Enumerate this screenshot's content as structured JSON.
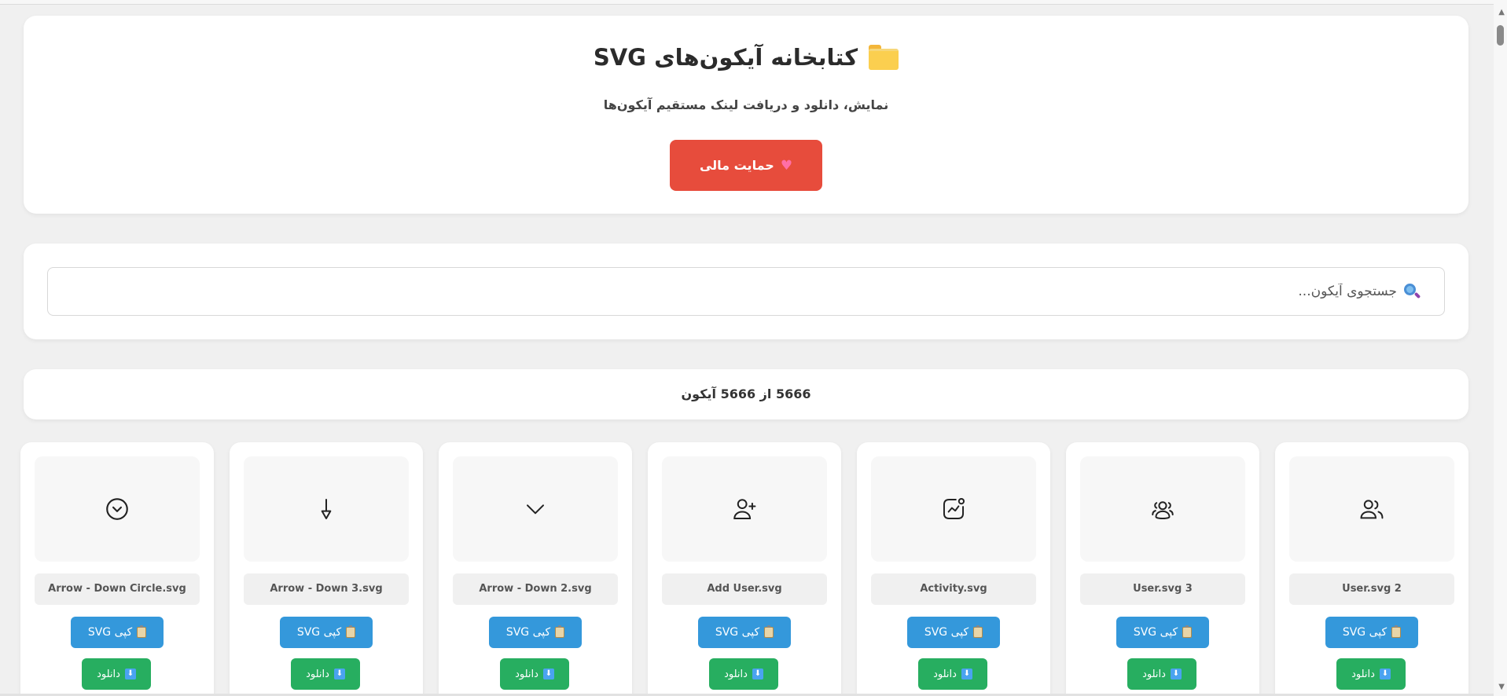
{
  "header": {
    "title": "کتابخانه آیکون‌های SVG",
    "folder_icon": "folder-icon",
    "subtitle": "نمایش، دانلود و دریافت لینک مستقیم آیکون‌ها",
    "donate_label": "حمایت مالی",
    "donate_icon": "heart-icon"
  },
  "search": {
    "placeholder": "جستجوی آیکون...",
    "icon": "search-icon"
  },
  "count": {
    "text": "5666 از 5666 آیکون"
  },
  "actions": {
    "copy_label": "کپی SVG",
    "download_label": "دانلود"
  },
  "icons": [
    {
      "filename": "User.svg 2",
      "icon": "users-icon"
    },
    {
      "filename": "User.svg 3",
      "icon": "group-icon"
    },
    {
      "filename": "Activity.svg",
      "icon": "activity-icon"
    },
    {
      "filename": "Add User.svg",
      "icon": "add-user-icon"
    },
    {
      "filename": "Arrow - Down 2.svg",
      "icon": "chevron-down-icon"
    },
    {
      "filename": "Arrow - Down 3.svg",
      "icon": "arrow-down-icon"
    },
    {
      "filename": "Arrow - Down Circle.svg",
      "icon": "arrow-down-circle-icon"
    }
  ],
  "colors": {
    "donate": "#e74c3c",
    "copy": "#3498db",
    "download": "#27ae60"
  }
}
